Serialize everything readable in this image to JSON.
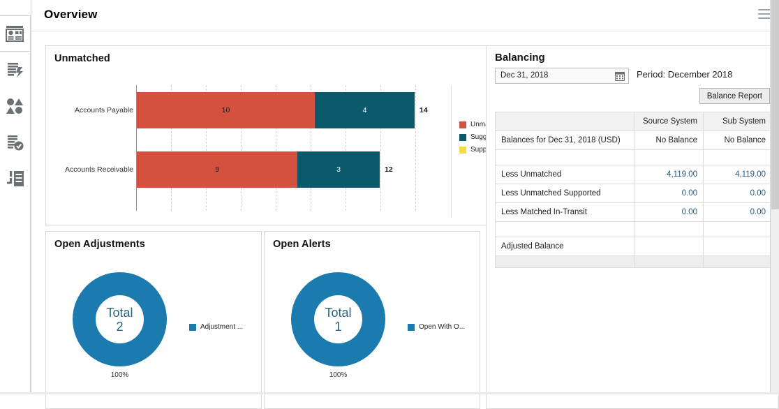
{
  "header": {
    "title": "Overview",
    "menu_icon": "hamburger-menu-icon"
  },
  "sidebar": {
    "items": [
      {
        "name": "dashboard",
        "icon": "dashboard-icon",
        "active": true
      },
      {
        "name": "auto-match",
        "icon": "document-lightning-icon",
        "active": false
      },
      {
        "name": "matching",
        "icon": "shapes-match-icon",
        "active": false
      },
      {
        "name": "reconciliation",
        "icon": "document-check-icon",
        "active": false
      },
      {
        "name": "rules",
        "icon": "list-rules-icon",
        "active": false
      }
    ]
  },
  "unmatched_panel": {
    "title": "Unmatched"
  },
  "adjustments_panel": {
    "title": "Open Adjustments",
    "total_label": "Total",
    "total_value": "2",
    "percent_label": "100%",
    "legend_label": "Adjustment ..."
  },
  "alerts_panel": {
    "title": "Open Alerts",
    "total_label": "Total",
    "total_value": "1",
    "percent_label": "100%",
    "legend_label": "Open With O..."
  },
  "balancing": {
    "title": "Balancing",
    "date_value": "Dec 31, 2018",
    "date_placeholder": "Dec 31, 2018",
    "calendar_icon": "calendar-icon",
    "period_text": "Period: December 2018",
    "balance_report_button": "Balance Report",
    "columns": [
      "",
      "Source System",
      "Sub System"
    ],
    "rows": [
      {
        "label": "Balances for Dec 31, 2018 (USD)",
        "source": "No Balance",
        "sub": "No Balance",
        "type": "text"
      },
      {
        "label": "",
        "source": "",
        "sub": "",
        "type": "spacer"
      },
      {
        "label": "Less Unmatched",
        "source": "4,119.00",
        "sub": "4,119.00",
        "type": "link"
      },
      {
        "label": "Less Unmatched Supported",
        "source": "0.00",
        "sub": "0.00",
        "type": "link"
      },
      {
        "label": "Less Matched In-Transit",
        "source": "0.00",
        "sub": "0.00",
        "type": "link"
      },
      {
        "label": "",
        "source": "",
        "sub": "",
        "type": "spacer"
      },
      {
        "label": "Adjusted Balance",
        "source": "",
        "sub": "",
        "type": "text"
      }
    ]
  },
  "colors": {
    "unmatched": "#d4503f",
    "suggested": "#0a5a6c",
    "supported": "#f2df3c",
    "donut": "#1b7bae",
    "link": "#1a5d8f"
  },
  "chart_data": [
    {
      "type": "bar",
      "orientation": "horizontal",
      "stacked": true,
      "title": "Unmatched",
      "categories": [
        "Accounts Payable",
        "Accounts Receivable"
      ],
      "series": [
        {
          "name": "Unmatched",
          "color": "#d4503f",
          "values": [
            10,
            9
          ]
        },
        {
          "name": "Suggested",
          "color": "#0a5a6c",
          "values": [
            4,
            3
          ]
        },
        {
          "name": "Supported",
          "color": "#f2df3c",
          "values": [
            0,
            0
          ]
        }
      ],
      "totals": [
        14,
        12
      ],
      "xlabel": "",
      "ylabel": "",
      "xlim": [
        0,
        20
      ],
      "grid": true,
      "legend_position": "right"
    },
    {
      "type": "pie",
      "variant": "donut",
      "title": "Open Adjustments",
      "labels": [
        "Adjustment ..."
      ],
      "values": [
        2
      ],
      "percentages": [
        "100%"
      ],
      "center_label": "Total",
      "center_value": "2",
      "colors": [
        "#1b7bae"
      ],
      "legend_position": "right"
    },
    {
      "type": "pie",
      "variant": "donut",
      "title": "Open Alerts",
      "labels": [
        "Open With O..."
      ],
      "values": [
        1
      ],
      "percentages": [
        "100%"
      ],
      "center_label": "Total",
      "center_value": "1",
      "colors": [
        "#1b7bae"
      ],
      "legend_position": "right"
    }
  ]
}
